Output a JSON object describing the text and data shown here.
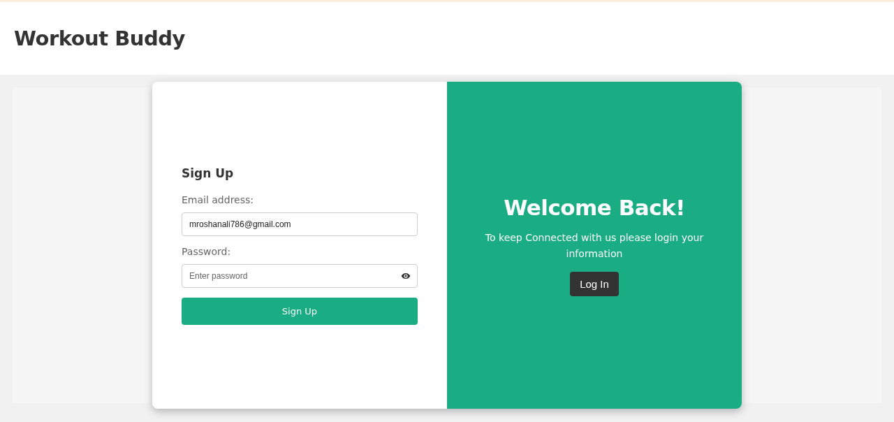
{
  "header": {
    "title": "Workout Buddy"
  },
  "signup": {
    "heading": "Sign Up",
    "email": {
      "label": "Email address:",
      "value": "mroshanali786@gmail.com"
    },
    "password": {
      "label": "Password:",
      "placeholder": "Enter password"
    },
    "button": "Sign Up"
  },
  "welcome": {
    "heading": "Welcome Back!",
    "text": "To keep Connected with us please login your information",
    "button": "Log In"
  }
}
